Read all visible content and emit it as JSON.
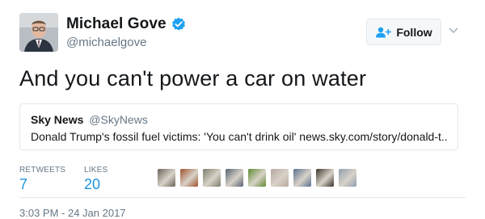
{
  "author": {
    "name": "Michael Gove",
    "handle": "@michaelgove",
    "verified_icon": "verified-badge-icon"
  },
  "actions": {
    "follow_label": "Follow",
    "follow_icon": "add-person-icon",
    "more_icon": "chevron-down-icon"
  },
  "tweet": {
    "text": "And you can't power a car on water"
  },
  "quoted": {
    "name": "Sky News",
    "handle": "@SkyNews",
    "text": "Donald Trump's fossil fuel victims: 'You can't drink oil' news.sky.com/story/donald-t..."
  },
  "stats": {
    "retweets_label": "RETWEETS",
    "retweets_count": "7",
    "likes_label": "LIKES",
    "likes_count": "20"
  },
  "likers": {
    "colors": [
      "#6b6258",
      "#a0522d",
      "#7a7d6a",
      "#566270",
      "#5f8a2e",
      "#b8a8a0",
      "#5a6f8f",
      "#3b332b",
      "#8f9fae"
    ]
  },
  "timestamp": "3:03 PM - 24 Jan 2017"
}
